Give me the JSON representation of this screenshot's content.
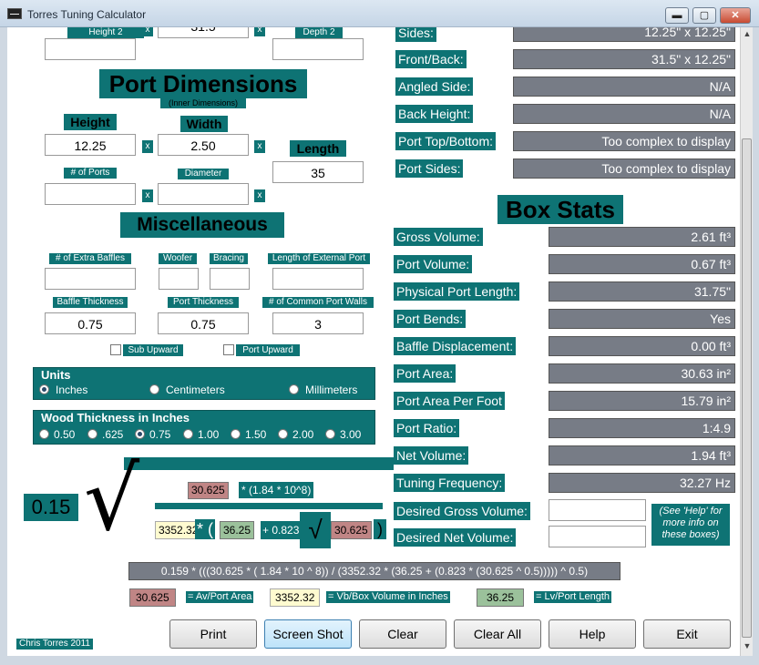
{
  "window": {
    "title": "Torres Tuning Calculator",
    "minimize": "▬",
    "maximize": "▢",
    "close": "✕"
  },
  "top": {
    "height2_label": "Height 2",
    "height2_value": "",
    "width2_value": "31.5",
    "depth2_label": "Depth 2",
    "depth2_value": "",
    "x": "x"
  },
  "port_dimensions": {
    "title": "Port Dimensions",
    "subtitle": "(Inner Dimensions)",
    "height_label": "Height",
    "height_value": "12.25",
    "width_label": "Width",
    "width_value": "2.50",
    "length_label": "Length",
    "length_value": "35",
    "num_ports_label": "# of Ports",
    "num_ports_value": "",
    "diameter_label": "Diameter",
    "diameter_value": ""
  },
  "misc": {
    "title": "Miscellaneous",
    "extra_baffles_label": "# of Extra Baffles",
    "extra_baffles_value": "",
    "woofer_label": "Woofer",
    "woofer_value": "",
    "bracing_label": "Bracing",
    "bracing_value": "",
    "ext_port_label": "Length of External Port",
    "ext_port_value": "",
    "baffle_thickness_label": "Baffle Thickness",
    "baffle_thickness_value": "0.75",
    "port_thickness_label": "Port Thickness",
    "port_thickness_value": "0.75",
    "common_walls_label": "# of Common Port Walls",
    "common_walls_value": "3",
    "sub_upward": "Sub Upward",
    "port_upward": "Port Upward"
  },
  "units": {
    "title": "Units",
    "options": [
      "Inches",
      "Centimeters",
      "Millimeters"
    ],
    "selected": "Inches"
  },
  "wood": {
    "title": "Wood Thickness in Inches",
    "options": [
      "0.50",
      ".625",
      "0.75",
      "1.00",
      "1.50",
      "2.00",
      "3.00"
    ],
    "selected": "0.75"
  },
  "formula": {
    "coefficient": "0.15",
    "radical": "√",
    "area": "30.625",
    "area_mult": "* (1.84 * 10^8)",
    "volume": "3352.32",
    "times_paren": "* (",
    "lv": "36.25",
    "plus": "+ 0.823",
    "area2": "30.625",
    "close_paren": ")",
    "full": "0.159 * (((30.625 * ( 1.84 * 10 ^ 8)) / (3352.32 * (36.25 + (0.823 * (30.625 ^ 0.5))))) ^ 0.5)"
  },
  "legend": [
    {
      "value": "30.625",
      "label": "= Av/Port Area"
    },
    {
      "value": "3352.32",
      "label": "= Vb/Box Volume in Inches"
    },
    {
      "value": "36.25",
      "label": "= Lv/Port Length"
    }
  ],
  "cut_list": [
    {
      "label": "Sides:",
      "value": "12.25\" x 12.25\""
    },
    {
      "label": "Front/Back:",
      "value": "31.5\" x 12.25\""
    },
    {
      "label": "Angled Side:",
      "value": "N/A"
    },
    {
      "label": "Back Height:",
      "value": "N/A"
    },
    {
      "label": "Port Top/Bottom:",
      "value": "Too complex to display"
    },
    {
      "label": "Port Sides:",
      "value": "Too complex to display"
    }
  ],
  "box_stats": {
    "title": "Box Stats",
    "rows": [
      {
        "label": "Gross Volume:",
        "value": "2.61 ft³"
      },
      {
        "label": "Port Volume:",
        "value": "0.67 ft³"
      },
      {
        "label": "Physical Port Length:",
        "value": "31.75\""
      },
      {
        "label": "Port Bends:",
        "value": "Yes"
      },
      {
        "label": "Baffle Displacement:",
        "value": "0.00 ft³"
      },
      {
        "label": "Port Area:",
        "value": "30.63 in²"
      },
      {
        "label": "Port Area Per Foot",
        "value": "15.79 in²"
      },
      {
        "label": "Port Ratio:",
        "value": "1:4.9"
      },
      {
        "label": "Net Volume:",
        "value": "1.94 ft³"
      },
      {
        "label": "Tuning Frequency:",
        "value": "32.27 Hz"
      }
    ],
    "desired_gross_label": "Desired Gross Volume:",
    "desired_gross_value": "",
    "desired_net_label": "Desired Net Volume:",
    "desired_net_value": "",
    "help_note": "(See 'Help' for more info on these boxes)"
  },
  "buttons": {
    "print": "Print",
    "screenshot": "Screen Shot",
    "clear": "Clear",
    "clear_all": "Clear All",
    "help": "Help",
    "exit": "Exit"
  },
  "credit": "Chris Torres 2011"
}
